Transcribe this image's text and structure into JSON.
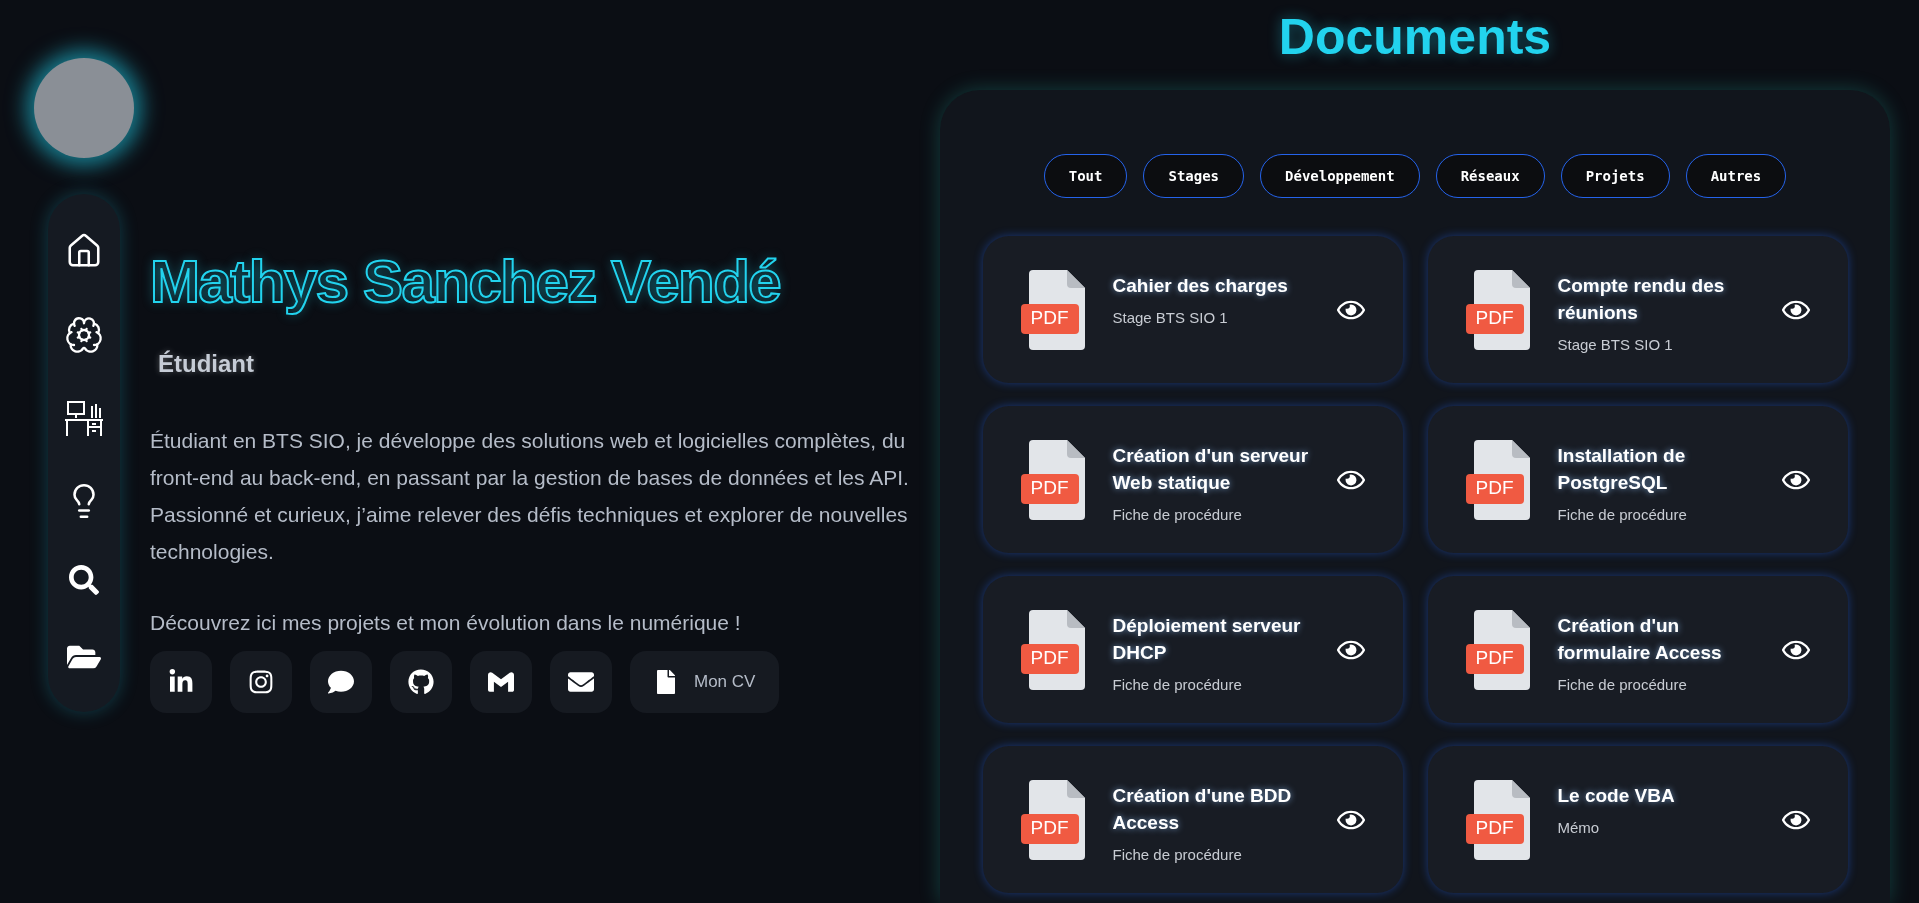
{
  "profile": {
    "name": "Mathys Sanchez Vendé",
    "role": "Étudiant",
    "bio": "Étudiant en BTS SIO, je développe des solutions web et logicielles complètes, du front-end au back-end, en passant par la gestion de bases de données et les API. Passionné et curieux, j’aime relever des défis techniques et explorer de nouvelles technologies.",
    "tagline": "Découvrez ici mes projets et mon évolution dans le numérique !",
    "cv_button": "Mon CV"
  },
  "documents": {
    "title": "Documents",
    "filters": [
      {
        "label": "Tout",
        "selected": false
      },
      {
        "label": "Stages",
        "selected": false
      },
      {
        "label": "Développement",
        "selected": false
      },
      {
        "label": "Réseaux",
        "selected": false
      },
      {
        "label": "Projets",
        "selected": false
      },
      {
        "label": "Autres",
        "selected": false
      }
    ],
    "cards": [
      {
        "file_type": "PDF",
        "title": "Cahier des charges",
        "subtitle": "Stage BTS SIO 1"
      },
      {
        "file_type": "PDF",
        "title": "Compte rendu des réunions",
        "subtitle": "Stage BTS SIO 1"
      },
      {
        "file_type": "PDF",
        "title": "Création d'un serveur Web statique",
        "subtitle": "Fiche de procédure"
      },
      {
        "file_type": "PDF",
        "title": "Installation de PostgreSQL",
        "subtitle": "Fiche de procédure"
      },
      {
        "file_type": "PDF",
        "title": "Déploiement serveur DHCP",
        "subtitle": "Fiche de procédure"
      },
      {
        "file_type": "PDF",
        "title": "Création d'un formulaire Access",
        "subtitle": "Fiche de procédure"
      },
      {
        "file_type": "PDF",
        "title": "Création d'une BDD Access",
        "subtitle": "Fiche de procédure"
      },
      {
        "file_type": "PDF",
        "title": "Le code VBA",
        "subtitle": "Mémo"
      }
    ]
  }
}
